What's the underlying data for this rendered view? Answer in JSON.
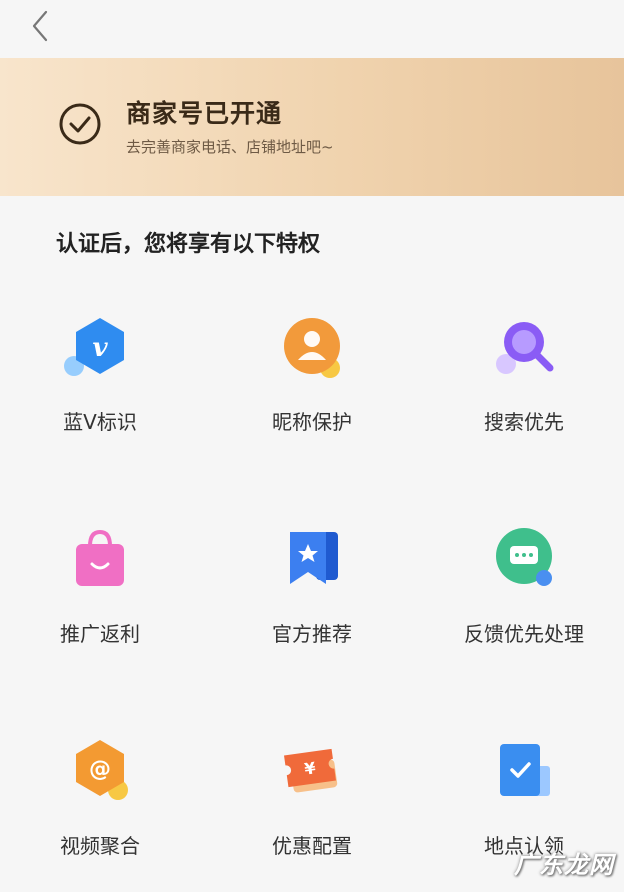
{
  "header": {
    "back_icon": "chevron-left-icon"
  },
  "banner": {
    "title": "商家号已开通",
    "subtitle": "去完善商家电话、店铺地址吧~",
    "icon": "check-circle-icon"
  },
  "section": {
    "title": "认证后，您将享有以下特权"
  },
  "features": [
    {
      "label": "蓝V标识",
      "icon": "blue-v-hexagon-icon",
      "color": "#2f8cf0"
    },
    {
      "label": "昵称保护",
      "icon": "user-avatar-icon",
      "color": "#f29a3b"
    },
    {
      "label": "搜索优先",
      "icon": "search-magnifier-icon",
      "color": "#8a5cf5"
    },
    {
      "label": "推广返利",
      "icon": "shopping-bag-icon",
      "color": "#f06fc4"
    },
    {
      "label": "官方推荐",
      "icon": "star-bookmark-icon",
      "color": "#3c7ff0"
    },
    {
      "label": "反馈优先处理",
      "icon": "chat-bubble-icon",
      "color": "#3fbf8c"
    },
    {
      "label": "视频聚合",
      "icon": "at-sign-hexagon-icon",
      "color": "#f39a32"
    },
    {
      "label": "优惠配置",
      "icon": "coupon-ticket-icon",
      "color": "#f06a3a"
    },
    {
      "label": "地点认领",
      "icon": "location-check-icon",
      "color": "#3a8ef0"
    }
  ],
  "watermark": {
    "text": "广东龙网"
  }
}
